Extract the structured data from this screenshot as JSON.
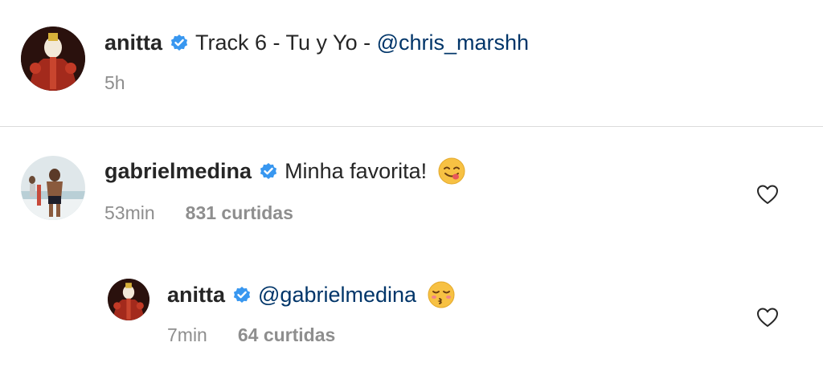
{
  "caption": {
    "username": "anitta",
    "text": "Track 6 - Tu y Yo - ",
    "mention": "@chris_marshh",
    "time": "5h"
  },
  "comments": [
    {
      "username": "gabrielmedina",
      "text": "Minha favorita!",
      "emoji": "savoring-face-emoji",
      "time": "53min",
      "likes": "831 curtidas"
    },
    {
      "username": "anitta",
      "mention": "@gabrielmedina",
      "emoji": "kissing-closed-eyes-emoji",
      "time": "7min",
      "likes": "64 curtidas"
    }
  ],
  "colors": {
    "text": "#262626",
    "secondary": "#8e8e8e",
    "mention": "#003569",
    "verified": "#3897f0",
    "divider": "#dbdbdb"
  }
}
